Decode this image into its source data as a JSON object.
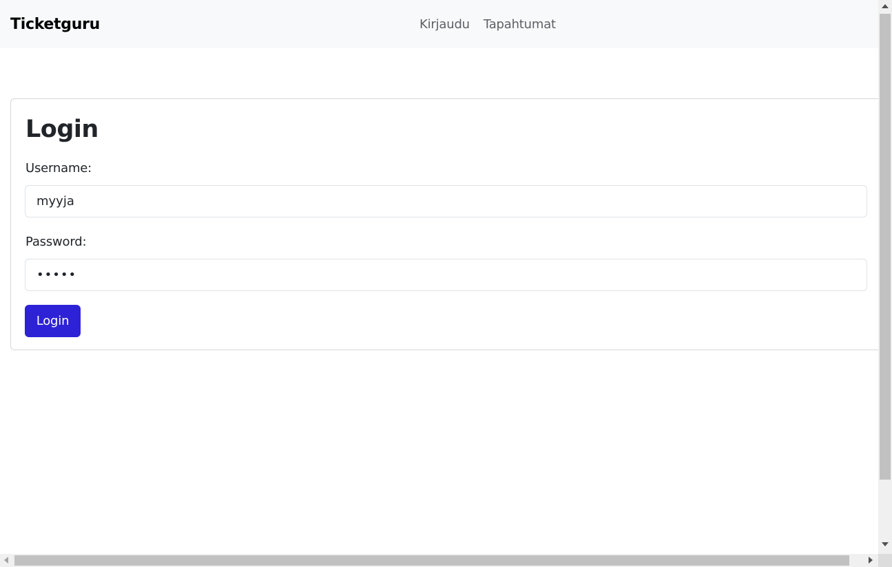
{
  "navbar": {
    "brand": "Ticketguru",
    "links": [
      {
        "label": "Kirjaudu"
      },
      {
        "label": "Tapahtumat"
      }
    ]
  },
  "login": {
    "title": "Login",
    "username_label": "Username:",
    "username_value": "myyja",
    "password_label": "Password:",
    "password_value": "•••••",
    "submit_label": "Login"
  },
  "colors": {
    "navbar_bg": "#f8f9fa",
    "button_bg": "#2d22d6",
    "card_border": "#d3d6da"
  }
}
